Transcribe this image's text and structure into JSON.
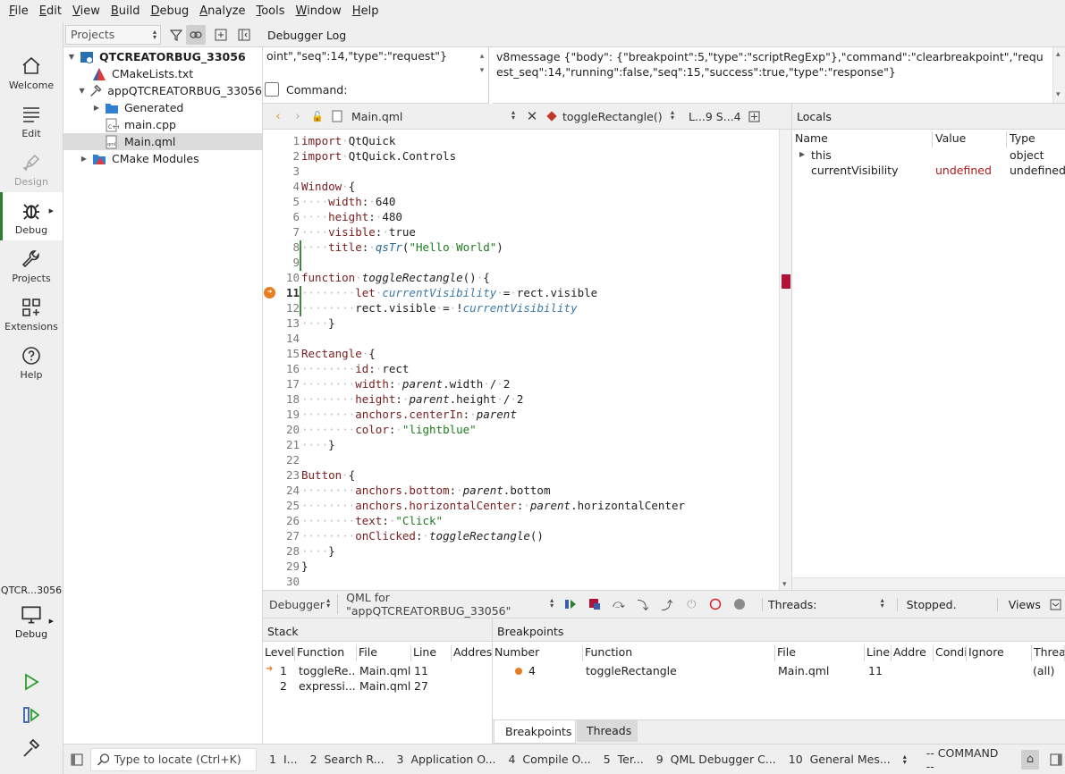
{
  "menu": [
    "File",
    "Edit",
    "View",
    "Build",
    "Debug",
    "Analyze",
    "Tools",
    "Window",
    "Help"
  ],
  "modes": [
    {
      "label": "Welcome",
      "icon": "home-icon"
    },
    {
      "label": "Edit",
      "icon": "edit-lines-icon"
    },
    {
      "label": "Design",
      "icon": "design-pen-icon"
    },
    {
      "label": "Debug",
      "icon": "bug-icon"
    },
    {
      "label": "Projects",
      "icon": "wrench-icon"
    },
    {
      "label": "Extensions",
      "icon": "extensions-grid-icon"
    },
    {
      "label": "Help",
      "icon": "help-circle-icon"
    }
  ],
  "kit": {
    "project_short": "QTCR...3056",
    "target_label": "Debug"
  },
  "projects": {
    "selector": "Projects",
    "tree": [
      {
        "label": "QTCREATORBUG_33056",
        "bold": true,
        "expand": "down",
        "icon": "project-icon",
        "indent": 0
      },
      {
        "label": "CMakeLists.txt",
        "expand": "",
        "icon": "cmake-file-icon",
        "indent": 1
      },
      {
        "label": "appQTCREATORBUG_33056",
        "expand": "down",
        "icon": "hammer-icon",
        "indent": 1
      },
      {
        "label": "Generated",
        "expand": "right",
        "icon": "folder-icon",
        "indent": 2
      },
      {
        "label": "main.cpp",
        "expand": "",
        "icon": "cpp-file-icon",
        "indent": 2
      },
      {
        "label": "Main.qml",
        "expand": "",
        "icon": "qml-file-icon",
        "indent": 2,
        "selected": true
      },
      {
        "label": "CMake Modules",
        "expand": "right",
        "icon": "cmake-folder-icon",
        "indent": 1
      }
    ]
  },
  "debugger_log": {
    "title": "Debugger Log",
    "left_text": "oint\",\"seq\":14,\"type\":\"request\"}",
    "command_label": "Command:",
    "right_text": "v8message {\"body\": {\"breakpoint\":5,\"type\":\"scriptRegExp\"},\"command\":\"clearbreakpoint\",\"request_seq\":14,\"running\":false,\"seq\":15,\"success\":true,\"type\":\"response\"}"
  },
  "editor": {
    "file": "Main.qml",
    "symbol": "toggleRectangle()",
    "position": "L...9 S...4",
    "current_line": 11,
    "lines": [
      "import QtQuick",
      "import QtQuick.Controls",
      "",
      "Window {",
      "    width: 640",
      "    height: 480",
      "    visible: true",
      "    title: qsTr(\"Hello World\")",
      "",
      "function toggleRectangle() {",
      "        let currentVisibility = rect.visible",
      "        rect.visible = !currentVisibility",
      "    }",
      "",
      "Rectangle {",
      "        id: rect",
      "        width: parent.width / 2",
      "        height: parent.height / 2",
      "        anchors.centerIn: parent",
      "        color: \"lightblue\"",
      "    }",
      "",
      "Button {",
      "        anchors.bottom: parent.bottom",
      "        anchors.horizontalCenter: parent.horizontalCenter",
      "        text: \"Click\"",
      "        onClicked: toggleRectangle()",
      "    }",
      "}",
      ""
    ]
  },
  "locals": {
    "title": "Locals",
    "columns": [
      "Name",
      "Value",
      "Type"
    ],
    "rows": [
      {
        "name": "this",
        "value": "",
        "type": "object",
        "expand": true
      },
      {
        "name": "currentVisibility",
        "value": "undefined",
        "type": "undefined",
        "expand": false
      }
    ]
  },
  "debug_toolbar": {
    "debugger": "Debugger",
    "engine": "QML for \"appQTCREATORBUG_33056\"",
    "threads_label": "Threads:",
    "state": "Stopped.",
    "views": "Views"
  },
  "stack": {
    "title": "Stack",
    "columns": [
      "Level",
      "Function",
      "File",
      "Line",
      "Address"
    ],
    "rows": [
      {
        "level": "1",
        "function": "toggleRe...",
        "file": "Main.qml",
        "line": "11",
        "current": true
      },
      {
        "level": "2",
        "function": "expressi...",
        "file": "Main.qml",
        "line": "27",
        "current": false
      }
    ]
  },
  "breakpoints": {
    "title": "Breakpoints",
    "columns": [
      "Number",
      "Function",
      "File",
      "Line",
      "Addre",
      "Condi",
      "Ignore",
      "Threa"
    ],
    "rows": [
      {
        "number": "4",
        "function": "toggleRectangle",
        "file": "Main.qml",
        "line": "11",
        "threads": "(all)"
      }
    ],
    "tabs": [
      "Breakpoints",
      "Threads"
    ]
  },
  "status": {
    "locator_placeholder": "Type to locate (Ctrl+K)",
    "panes": [
      "1  I...",
      "2  Search R...",
      "3  Application O...",
      "4  Compile O...",
      "5  Ter...",
      "9  QML Debugger C...",
      "10  General Mes..."
    ],
    "mode": "-- COMMAND --"
  },
  "colors": {
    "accent": "#2f7d2f",
    "keyword": "#7a2020",
    "string": "#1f7a1f",
    "local_var": "#3b7aa8",
    "undefined_value": "#b01c1c",
    "breakpoint": "#e67e22"
  }
}
